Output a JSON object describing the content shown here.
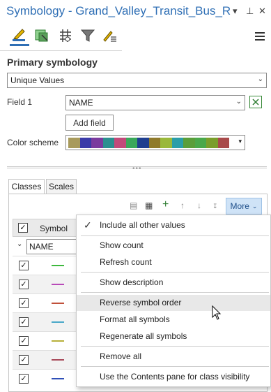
{
  "window": {
    "title": "Symbology - Grand_Valley_Transit_Bus_Rou...",
    "controls": [
      "▾",
      "⊥",
      "✕"
    ]
  },
  "toolbar": {
    "tools": [
      "primary-symbology",
      "vary-symbology",
      "symbol-layers",
      "filter",
      "more-symbology"
    ]
  },
  "primary": {
    "heading": "Primary symbology",
    "method": "Unique Values",
    "field1_label": "Field 1",
    "field1_value": "NAME",
    "add_field": "Add field",
    "color_scheme_label": "Color scheme",
    "color_scheme_colors": [
      "#a89a5c",
      "#3a3aa8",
      "#7a3a9e",
      "#2b8f8f",
      "#c24a7a",
      "#3aa85a",
      "#1f3f8f",
      "#8f7a2b",
      "#9ab83a",
      "#2b9ea8",
      "#5a9e3a",
      "#4aa84a",
      "#7a9e2b",
      "#a84a4a"
    ]
  },
  "tabs": {
    "classes": "Classes",
    "scales": "Scales"
  },
  "classes": {
    "more": "More",
    "column_symbol": "Symbol",
    "group_field": "NAME",
    "rows": [
      {
        "color": "#3db83d"
      },
      {
        "color": "#b84ab8"
      },
      {
        "color": "#c0503a"
      },
      {
        "color": "#4aa8c8"
      },
      {
        "color": "#b8b03a"
      },
      {
        "color": "#a84a5a"
      },
      {
        "color": "#2f4fb8"
      }
    ]
  },
  "menu": {
    "include_all": "Include all other values",
    "show_count": "Show count",
    "refresh_count": "Refresh count",
    "show_description": "Show description",
    "reverse_order": "Reverse symbol order",
    "format_all": "Format all symbols",
    "regenerate_all": "Regenerate all symbols",
    "remove_all": "Remove all",
    "contents_pane": "Use the Contents pane for class visibility"
  }
}
